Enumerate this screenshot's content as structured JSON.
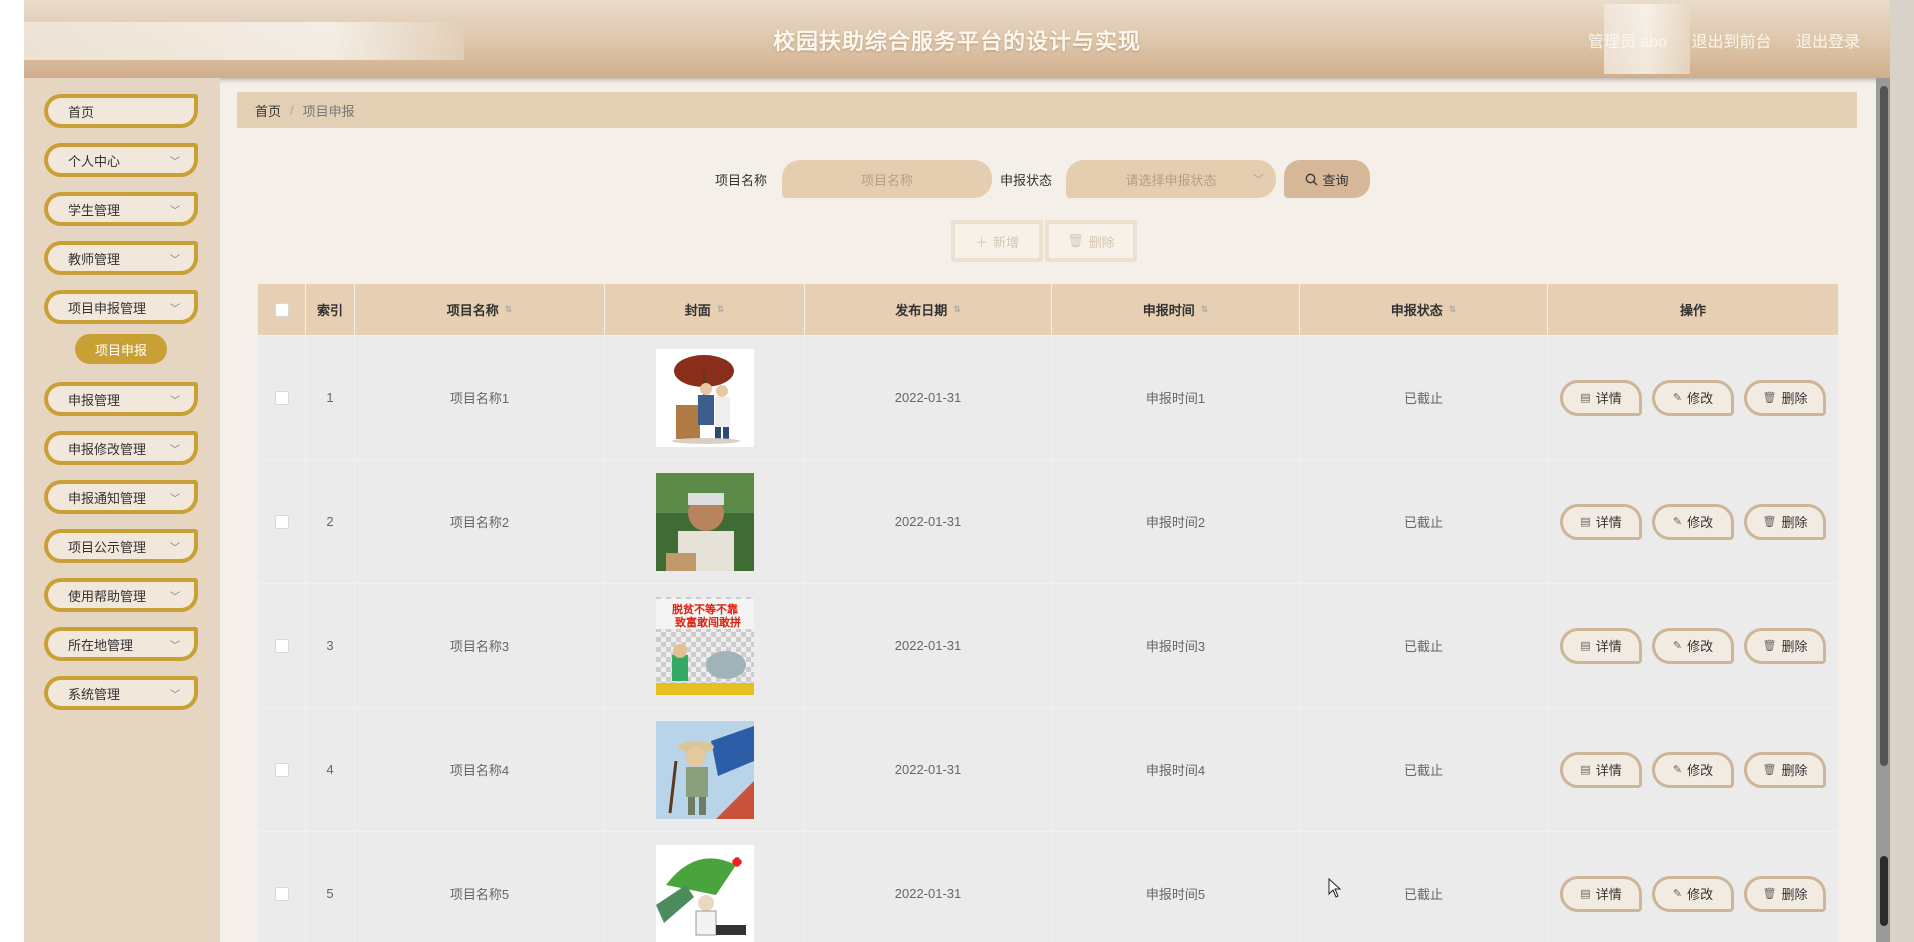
{
  "header": {
    "title": "校园扶助综合服务平台的设计与实现",
    "user": "管理员 abo",
    "to_front": "退出到前台",
    "logout": "退出登录"
  },
  "sidebar": {
    "items": [
      {
        "label": "首页",
        "has_arrow": false
      },
      {
        "label": "个人中心",
        "has_arrow": true
      },
      {
        "label": "学生管理",
        "has_arrow": true
      },
      {
        "label": "教师管理",
        "has_arrow": true
      },
      {
        "label": "项目申报管理",
        "has_arrow": true
      },
      {
        "label": "申报管理",
        "has_arrow": true
      },
      {
        "label": "申报修改管理",
        "has_arrow": true
      },
      {
        "label": "申报通知管理",
        "has_arrow": true
      },
      {
        "label": "项目公示管理",
        "has_arrow": true
      },
      {
        "label": "使用帮助管理",
        "has_arrow": true
      },
      {
        "label": "所在地管理",
        "has_arrow": true
      },
      {
        "label": "系统管理",
        "has_arrow": true
      }
    ],
    "active_sub": "项目申报"
  },
  "breadcrumb": {
    "home": "首页",
    "separator": "/",
    "current": "项目申报"
  },
  "search": {
    "name_label": "项目名称",
    "name_placeholder": "项目名称",
    "status_label": "申报状态",
    "status_placeholder": "请选择申报状态",
    "query_label": "查询"
  },
  "actions": {
    "add_label": "新增",
    "delete_label": "删除"
  },
  "table": {
    "columns": [
      "索引",
      "项目名称",
      "封面",
      "发布日期",
      "申报时间",
      "申报状态",
      "操作"
    ],
    "rows": [
      {
        "index": "1",
        "name": "项目名称1",
        "date": "2022-01-31",
        "time": "申报时间1",
        "status": "已截止"
      },
      {
        "index": "2",
        "name": "项目名称2",
        "date": "2022-01-31",
        "time": "申报时间2",
        "status": "已截止"
      },
      {
        "index": "3",
        "name": "项目名称3",
        "date": "2022-01-31",
        "time": "申报时间3",
        "status": "已截止"
      },
      {
        "index": "4",
        "name": "项目名称4",
        "date": "2022-01-31",
        "time": "申报时间4",
        "status": "已截止"
      },
      {
        "index": "5",
        "name": "项目名称5",
        "date": "2022-01-31",
        "time": "申报时间5",
        "status": "已截止"
      }
    ],
    "row_actions": {
      "detail": "详情",
      "edit": "修改",
      "delete": "删除"
    }
  },
  "cover_banner_text": "脱贫不等不靠 致富敢闯敢拼",
  "colors": {
    "accent": "#c9a035",
    "header_bg": "#dcc3a6",
    "table_head": "#e6cfb2",
    "sidebar_bg": "#e6d5c0"
  }
}
